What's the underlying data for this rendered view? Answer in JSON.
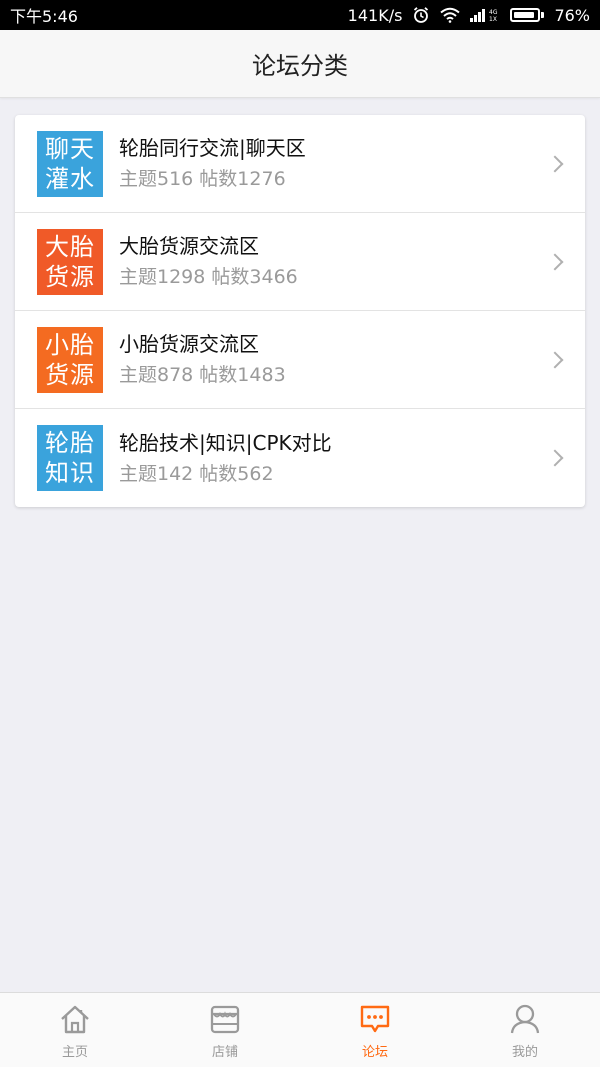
{
  "status_bar": {
    "time": "下午5:46",
    "network_speed": "141K/s",
    "battery_percent": "76%",
    "icons": [
      "alarm-icon",
      "wifi-icon",
      "signal-icon",
      "battery-icon"
    ]
  },
  "header": {
    "title": "论坛分类"
  },
  "forums": [
    {
      "icon_line1": "聊天",
      "icon_line2": "灌水",
      "icon_color": "#3aa3dc",
      "title": "轮胎同行交流|聊天区",
      "stats": "主题516 帖数1276"
    },
    {
      "icon_line1": "大胎",
      "icon_line2": "货源",
      "icon_color": "#f05a28",
      "title": "大胎货源交流区",
      "stats": "主题1298 帖数3466"
    },
    {
      "icon_line1": "小胎",
      "icon_line2": "货源",
      "icon_color": "#f46b21",
      "title": "小胎货源交流区",
      "stats": "主题878 帖数1483"
    },
    {
      "icon_line1": "轮胎",
      "icon_line2": "知识",
      "icon_color": "#3aa3dc",
      "title": "轮胎技术|知识|CPK对比",
      "stats": "主题142 帖数562"
    }
  ],
  "bottom_nav": {
    "items": [
      {
        "label": "主页",
        "icon": "home-icon",
        "active": false
      },
      {
        "label": "店铺",
        "icon": "store-icon",
        "active": false
      },
      {
        "label": "论坛",
        "icon": "forum-icon",
        "active": true
      },
      {
        "label": "我的",
        "icon": "profile-icon",
        "active": false
      }
    ],
    "active_color": "#ff6a13",
    "inactive_color": "#9a9a9a"
  }
}
